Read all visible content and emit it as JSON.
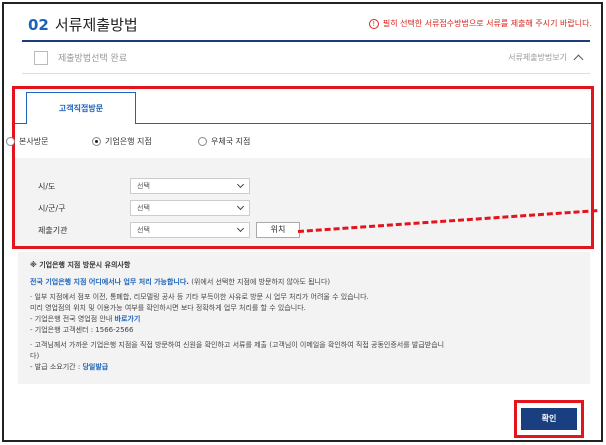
{
  "header": {
    "num": "02",
    "title": "서류제출방법",
    "notice": "필히 선택한 서류접수방법으로 서류를 제출해 주시기 바랍니다."
  },
  "status": {
    "label": "제출방법선택 완료",
    "view_label": "서류제출방법보기"
  },
  "tab": {
    "label": "고객직접방문"
  },
  "radios": [
    {
      "label": "본사방문",
      "checked": false
    },
    {
      "label": "기업은행 지점",
      "checked": true
    },
    {
      "label": "우체국 지점",
      "checked": false
    }
  ],
  "form": {
    "province_label": "시/도",
    "city_label": "시/군/구",
    "branch_label": "제출기관",
    "select_value": "선택",
    "position_button": "위치"
  },
  "info": {
    "title": "※ 기업은행 지점 방문시 유의사항",
    "line1_bold": "전국 기업은행 지점 어디에서나 업무 처리 가능합니다.",
    "line1_rest": "(위에서 선택한 지점에 방문하지 않아도 됩니다)",
    "line2": "· 일부 지점에서 점포 이전, 통폐합, 리모델링 공사 등 기타 부득이한 사유로 방문 시 업무 처리가 어려울 수 있습니다.",
    "line3": "미리 영업점의 위치 및 이용가능 여부를 확인하시면 보다 정확하게 업무 처리를 할 수 있습니다.",
    "line4_prefix": "- 기업은행 전국 영업점 안내",
    "line4_link": "바로가기",
    "line5": "- 기업은행 고객센터 : 1566-2566",
    "line6": "· 고객님께서 가까운 기업은행 지점을 직접 방문하여 신원을 확인하고 서류를 제출 (고객님이 이메일을 확인하여 직접 공동인증서를 발급받습니",
    "line6b": "다)",
    "line7_prefix": "- 발급 소요기간 :",
    "line7_value": "당일발급"
  },
  "confirm_button": "확인",
  "colors": {
    "accent": "#1c64b8",
    "highlight": "#e3141b",
    "primary_button": "#1a3f80"
  }
}
